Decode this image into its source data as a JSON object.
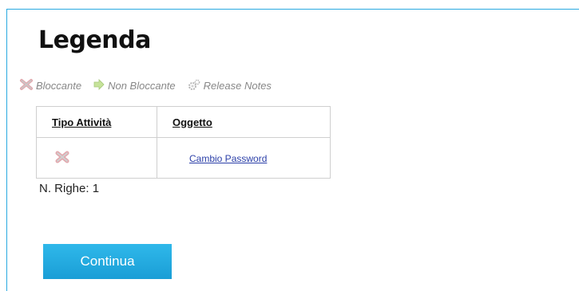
{
  "page": {
    "title": "Legenda",
    "accent_color": "#29a9e1"
  },
  "legend": [
    {
      "icon": "blocking-x-icon",
      "label": "Bloccante"
    },
    {
      "icon": "non-blocking-arrow-icon",
      "label": "Non Bloccante"
    },
    {
      "icon": "release-notes-gear-icon",
      "label": "Release Notes"
    }
  ],
  "table": {
    "headers": [
      "Tipo Attività",
      "Oggetto"
    ],
    "rows": [
      {
        "tipo_icon": "blocking-x-icon",
        "oggetto": "Cambio Password"
      }
    ]
  },
  "footer": {
    "row_count": "N. Righe: 1"
  },
  "actions": {
    "continue_label": "Continua",
    "button_color": "#1fa8e0"
  }
}
